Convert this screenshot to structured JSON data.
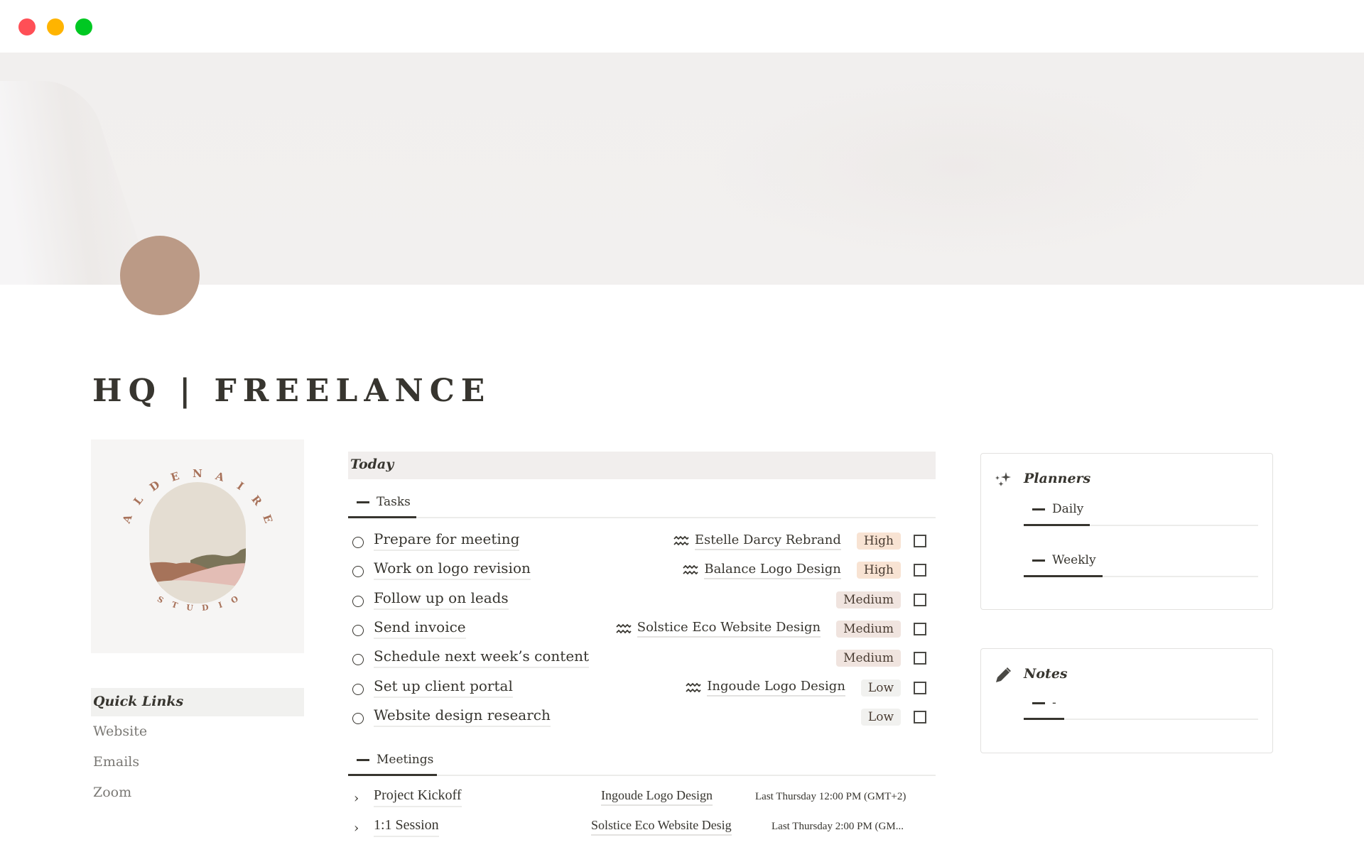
{
  "window": {
    "controls": [
      "close",
      "minimize",
      "maximize"
    ],
    "colors": {
      "close": "#ff4f56",
      "minimize": "#ffb400",
      "maximize": "#00c822"
    }
  },
  "page": {
    "title": "HQ | FREELANCE",
    "avatar_color": "#bb9a86"
  },
  "logo": {
    "top_text": "ALDENAIRE",
    "bottom_text": "STUDIO",
    "letters_top": [
      "A",
      "L",
      "D",
      "E",
      "N",
      "A",
      "I",
      "R",
      "E"
    ],
    "letters_bottom": [
      "S",
      "T",
      "U",
      "D",
      "I",
      "O"
    ],
    "accent_color": "#a8725a"
  },
  "quick_links": {
    "header": "Quick Links",
    "items": [
      "Website",
      "Emails",
      "Zoom"
    ]
  },
  "today": {
    "header": "Today",
    "tasks_tab": "Tasks",
    "meetings_tab": "Meetings",
    "tasks": [
      {
        "title": "Prepare for meeting",
        "project": "Estelle Darcy Rebrand",
        "priority": "High",
        "done": false
      },
      {
        "title": "Work on logo revision",
        "project": "Balance Logo Design",
        "priority": "High",
        "done": false
      },
      {
        "title": "Follow up on leads",
        "project": "",
        "priority": "Medium",
        "done": false
      },
      {
        "title": "Send invoice",
        "project": "Solstice Eco Website Design",
        "priority": "Medium",
        "done": false
      },
      {
        "title": "Schedule next week’s content",
        "project": "",
        "priority": "Medium",
        "done": false
      },
      {
        "title": "Set up client portal",
        "project": "Ingoude Logo Design",
        "priority": "Low",
        "done": false
      },
      {
        "title": "Website design research",
        "project": "",
        "priority": "Low",
        "done": false
      }
    ],
    "meetings": [
      {
        "title": "Project Kickoff",
        "project": "Ingoude Logo Design",
        "date": "Last Thursday 12:00 PM (GMT+2)"
      },
      {
        "title": "1:1 Session",
        "project": "Solstice Eco Website Desig",
        "date": "Last Thursday 2:00 PM (GM..."
      }
    ],
    "priority_colors": {
      "High": "#f8e3d3",
      "Medium": "#f0e4df",
      "Low": "#f1f1ef"
    }
  },
  "planners": {
    "icon": "sparkles-icon",
    "title": "Planners",
    "tabs": [
      "Daily",
      "Weekly"
    ]
  },
  "notes": {
    "icon": "pencil-icon",
    "title": "Notes",
    "tabs": [
      "-"
    ]
  }
}
